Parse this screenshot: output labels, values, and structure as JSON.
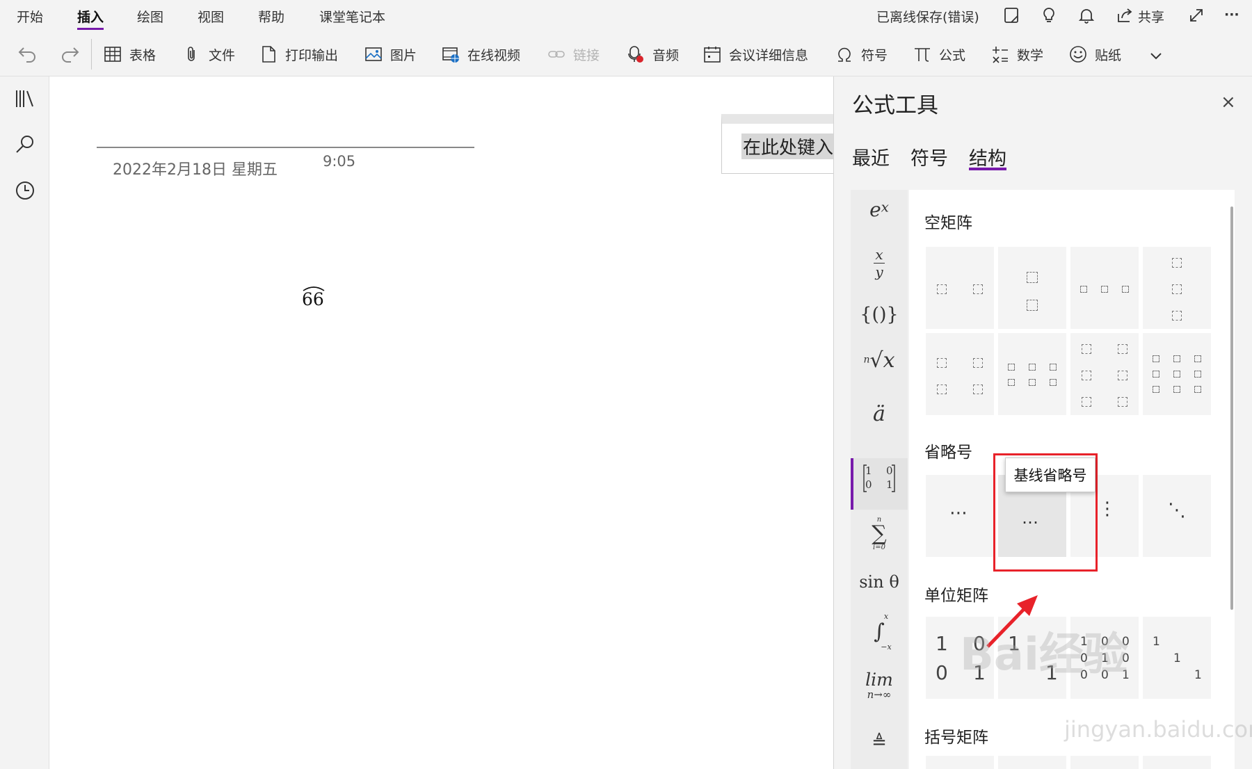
{
  "menu": [
    "开始",
    "插入",
    "绘图",
    "视图",
    "帮助",
    "课堂笔记本"
  ],
  "status": "已离线保存(错误)",
  "share_label": "共享",
  "more_label": "···",
  "toolbar": {
    "table": "表格",
    "file": "文件",
    "printout": "打印输出",
    "picture": "图片",
    "online_video": "在线视频",
    "link": "链接",
    "audio": "音频",
    "meeting": "会议详细信息",
    "symbol": "符号",
    "equation": "公式",
    "math": "数学",
    "sticker": "贴纸"
  },
  "page": {
    "date": "2022年2月18日 星期五",
    "time": "9:05",
    "equation": "66",
    "note_placeholder": "在此处键入"
  },
  "pane": {
    "title": "公式工具",
    "close": "×",
    "tabs": [
      "最近",
      "符号",
      "结构"
    ],
    "categories": {
      "script": "e",
      "script_sup": "x",
      "frac_top": "x",
      "frac_bottom": "y",
      "bracket": "{()}",
      "radical_index": "n",
      "radical": "√x",
      "accent": "ä",
      "matrix_a": "1",
      "matrix_b": "0",
      "matrix_c": "0",
      "matrix_d": "1",
      "sum_top": "n",
      "sum": "∑",
      "sum_bottom": "i=0",
      "func": "sin θ",
      "int_top": "x",
      "int": "∫",
      "int_bottom": "−x",
      "lim": "lim",
      "lim_bottom": "n→∞",
      "operator": "≜"
    },
    "sections": {
      "empty_matrix": "空矩阵",
      "dots": "省略号",
      "identity": "单位矩阵",
      "bracket_matrix": "括号矩阵"
    },
    "dots_glyphs": [
      "⋯",
      "…",
      "⋮",
      "⋱"
    ],
    "identity": {
      "one": "1",
      "zero": "0"
    },
    "tooltip": "基线省略号"
  },
  "watermark": "Bai经验",
  "watermark_sub": "jingyan.baidu.com",
  "colors": {
    "accent": "#7719aa",
    "highlight": "#e8222a"
  }
}
